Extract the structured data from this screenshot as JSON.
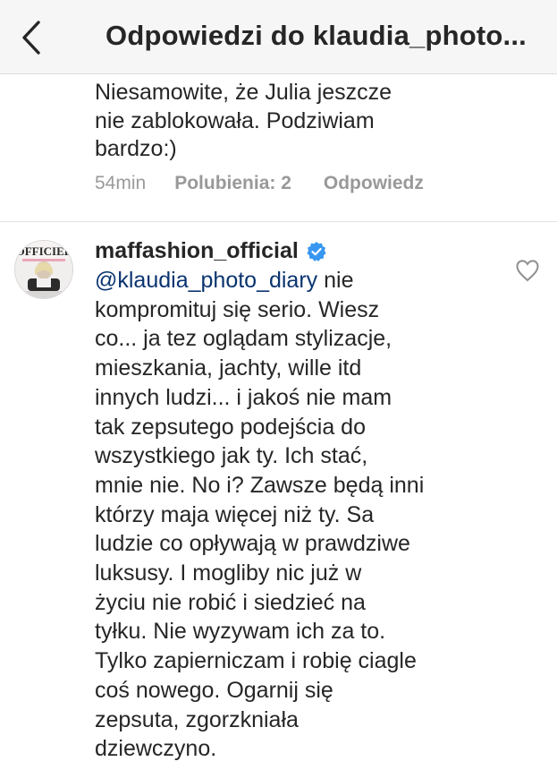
{
  "header": {
    "title": "Odpowiedzi do klaudia_photo..."
  },
  "previous_comment": {
    "text": "Niesamowite, że Julia jeszcze\nnie zablokowała. Podziwiam\nbardzo:)",
    "time": "54min",
    "likes_label": "Polubienia: 2",
    "reply_label": "Odpowiedz"
  },
  "comment": {
    "avatar_text": "OFFICIEL",
    "username": "maffashion_official",
    "mention": "@klaudia_photo_diary",
    "lines": [
      " nie",
      "kompromituj się serio. Wiesz",
      "co... ja tez oglądam stylizacje,",
      "mieszkania, jachty, wille itd",
      "innych ludzi... i jakoś nie mam",
      "tak zepsutego podejścia do",
      "wszystkiego jak ty. Ich stać,",
      "mnie nie. No i? Zawsze będą inni",
      "którzy maja więcej niż ty. Sa",
      "ludzie co opływają w prawdziwe",
      "luksusy. I mogliby nic już w",
      "życiu nie robić i siedzieć na",
      "tyłku. Nie wyzywam ich za to.",
      "Tylko zapierniczam i robię ciagle",
      "coś nowego. Ogarnij się",
      "zepsuta, zgorzkniała",
      "dziewczyno."
    ]
  },
  "colors": {
    "mention": "#0a3470",
    "verified_badge": "#3897f0",
    "meta_text": "#999999"
  }
}
